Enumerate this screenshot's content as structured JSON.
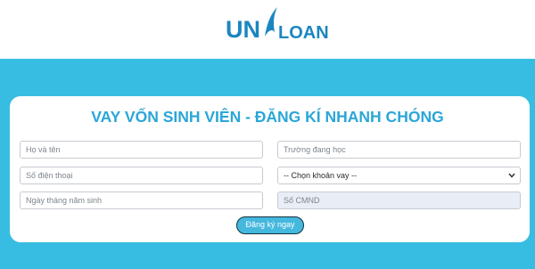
{
  "brand": {
    "logo_part1": "UN",
    "logo_part2": "LOAN",
    "color": "#1b86c0"
  },
  "form": {
    "title": "VAY VỐN SINH VIÊN - ĐĂNG KÍ NHANH CHÓNG",
    "full_name_placeholder": "Họ và tên",
    "school_placeholder": "Trường đang học",
    "phone_placeholder": "Số điện thoại",
    "loan_select_value": "-- Chọn khoản vay --",
    "dob_placeholder": "Ngày tháng năm sinh",
    "id_placeholder": "Số CMND",
    "submit_label": "Đăng ký ngay"
  },
  "colors": {
    "hero_background": "#38bde2",
    "title": "#2aa6d8",
    "button": "#45b8de",
    "disabled_field": "#e9eef6"
  }
}
